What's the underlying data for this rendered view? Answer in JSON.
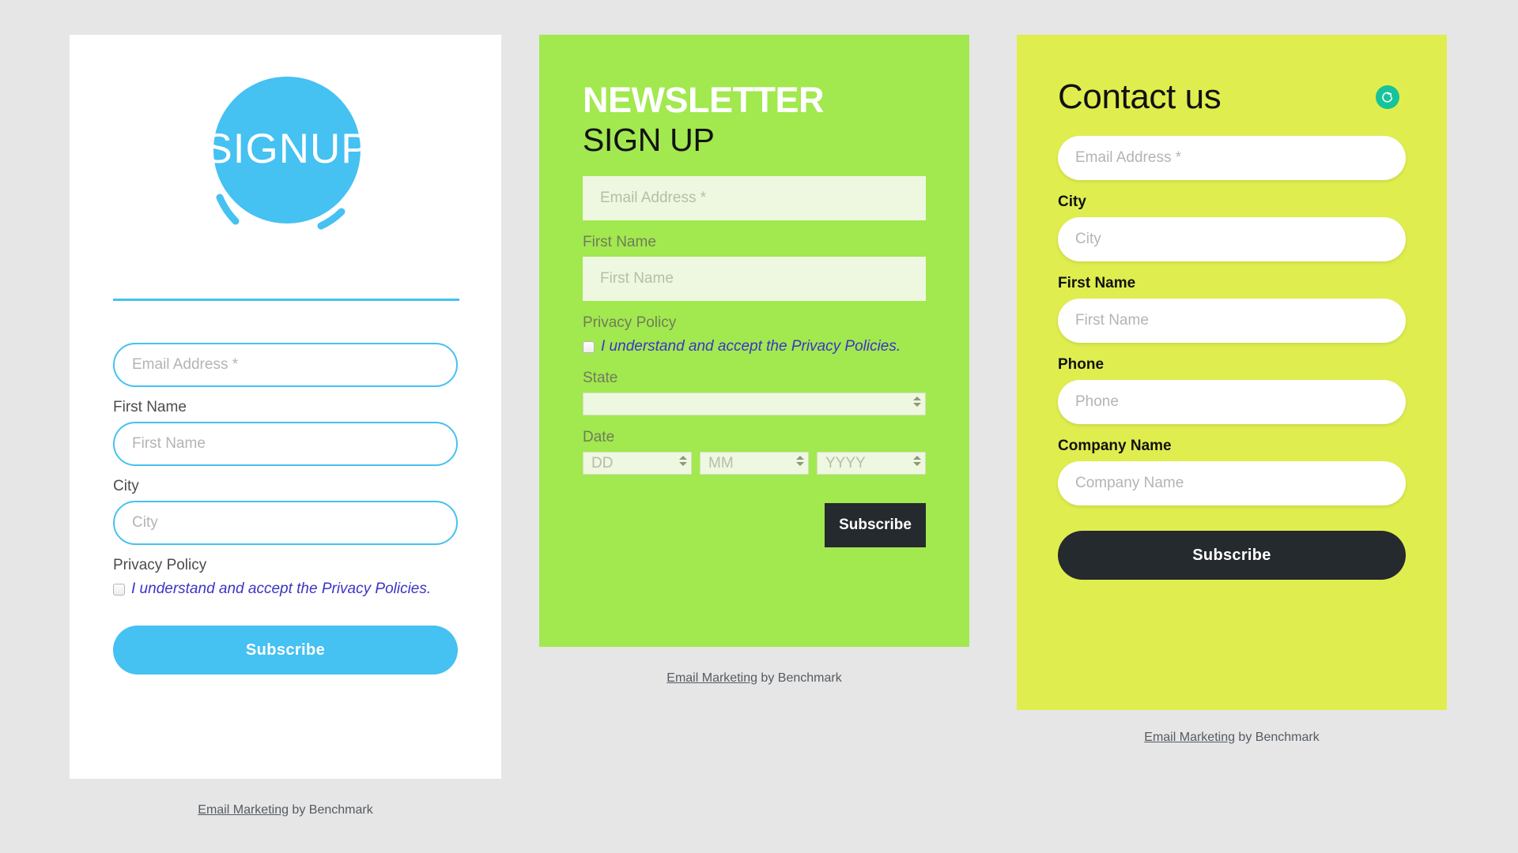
{
  "page": {
    "background_color": "#e6e6e7"
  },
  "left_form": {
    "logo": {
      "text": "SIGNUP",
      "circle_color": "#45c1f2",
      "ring_color": "#ffffff"
    },
    "accent_color": "#45c1f2",
    "email": {
      "label": "",
      "placeholder": "Email Address *",
      "value": ""
    },
    "first_name": {
      "label": "First Name",
      "placeholder": "First Name",
      "value": ""
    },
    "city": {
      "label": "City",
      "placeholder": "City",
      "value": ""
    },
    "privacy": {
      "label": "Privacy Policy",
      "checkbox_checked": false,
      "link_text": "I understand and accept the Privacy Policies."
    },
    "submit_label": "Subscribe",
    "footer": {
      "link": "Email Marketing",
      "suffix": " by Benchmark"
    }
  },
  "middle_form": {
    "background_color": "#a2e84f",
    "title_line1": "NEWSLETTER",
    "title_line2": "SIGN UP",
    "email": {
      "placeholder": "Email Address *",
      "value": ""
    },
    "first_name": {
      "label": "First Name",
      "placeholder": "First Name",
      "value": ""
    },
    "privacy": {
      "label": "Privacy Policy",
      "checkbox_checked": false,
      "link_text": "I understand and accept the Privacy Policies."
    },
    "state": {
      "label": "State",
      "selected": "",
      "options": []
    },
    "date": {
      "label": "Date",
      "day": {
        "selected": "DD"
      },
      "month": {
        "selected": "MM"
      },
      "year": {
        "selected": "YYYY"
      }
    },
    "submit_label": "Subscribe",
    "footer": {
      "link": "Email Marketing",
      "suffix": " by Benchmark"
    }
  },
  "right_form": {
    "background_color": "#dfee4e",
    "title": "Contact us",
    "badge_icon": "refresh-icon",
    "badge_color": "#17c39a",
    "email": {
      "placeholder": "Email Address *",
      "value": ""
    },
    "city": {
      "label": "City",
      "placeholder": "City",
      "value": ""
    },
    "first_name": {
      "label": "First Name",
      "placeholder": "First Name",
      "value": ""
    },
    "phone": {
      "label": "Phone",
      "placeholder": "Phone",
      "value": ""
    },
    "company": {
      "label": "Company Name",
      "placeholder": "Company Name",
      "value": ""
    },
    "submit_label": "Subscribe",
    "footer": {
      "link": "Email Marketing",
      "suffix": " by Benchmark"
    }
  }
}
